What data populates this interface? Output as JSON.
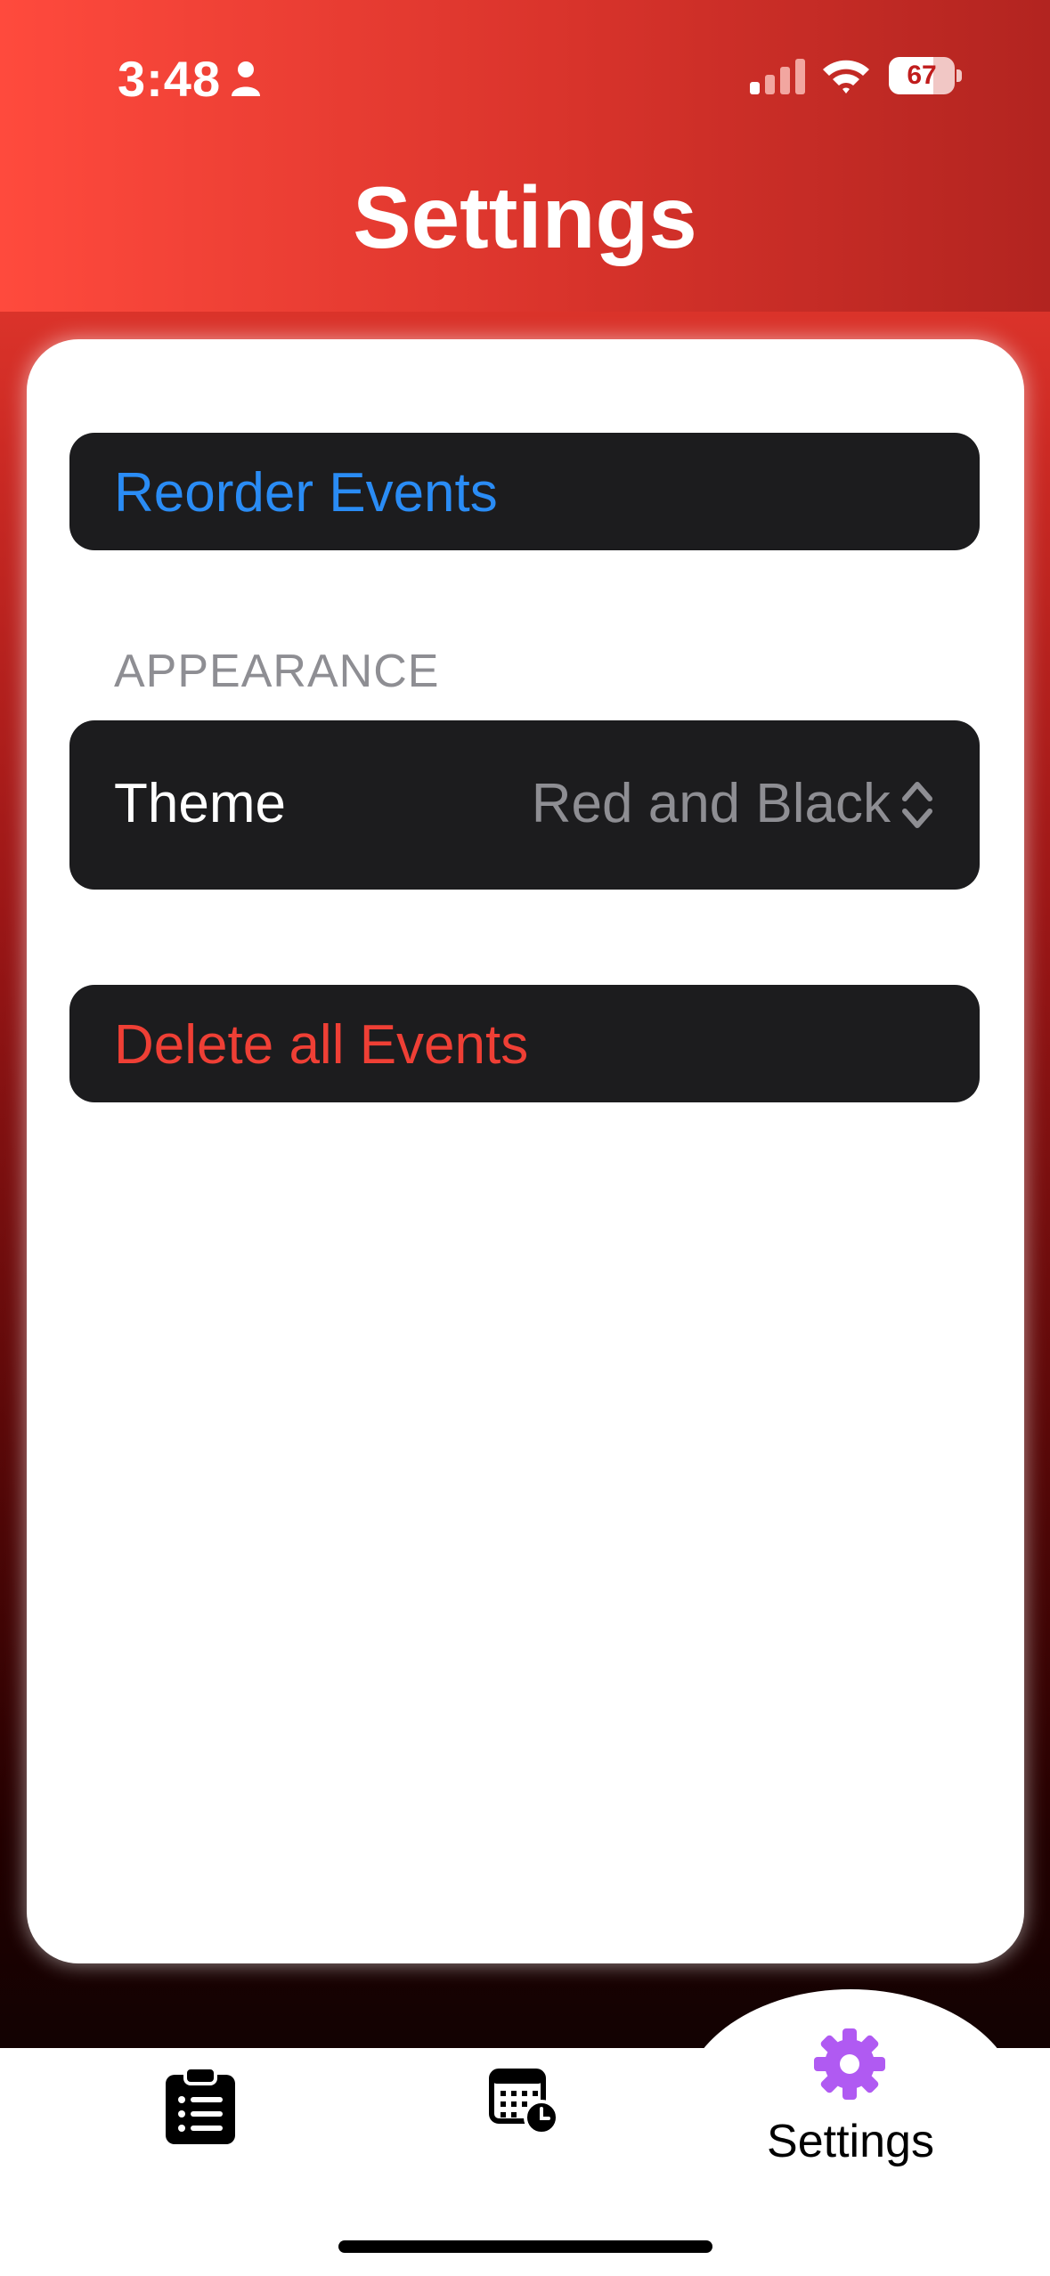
{
  "status_bar": {
    "time": "3:48",
    "battery_level": "67",
    "battery_fraction": 0.67
  },
  "header": {
    "title": "Settings"
  },
  "settings": {
    "reorder_label": "Reorder Events",
    "appearance_header": "APPEARANCE",
    "theme_label": "Theme",
    "theme_value": "Red and Black",
    "delete_label": "Delete all Events"
  },
  "tab_bar": {
    "tabs": [
      {
        "id": "events",
        "icon": "clipboard-list-icon"
      },
      {
        "id": "calendar",
        "icon": "calendar-clock-icon"
      },
      {
        "id": "settings",
        "icon": "gear-icon",
        "label": "Settings",
        "selected": true
      }
    ]
  },
  "colors": {
    "accent_red": "#ff4436",
    "link_blue": "#2a8cf5",
    "destructive_red": "#ef3f35",
    "row_background": "#1c1c1e",
    "secondary_text": "#8e8e93",
    "selected_tab": "#b05af2"
  }
}
